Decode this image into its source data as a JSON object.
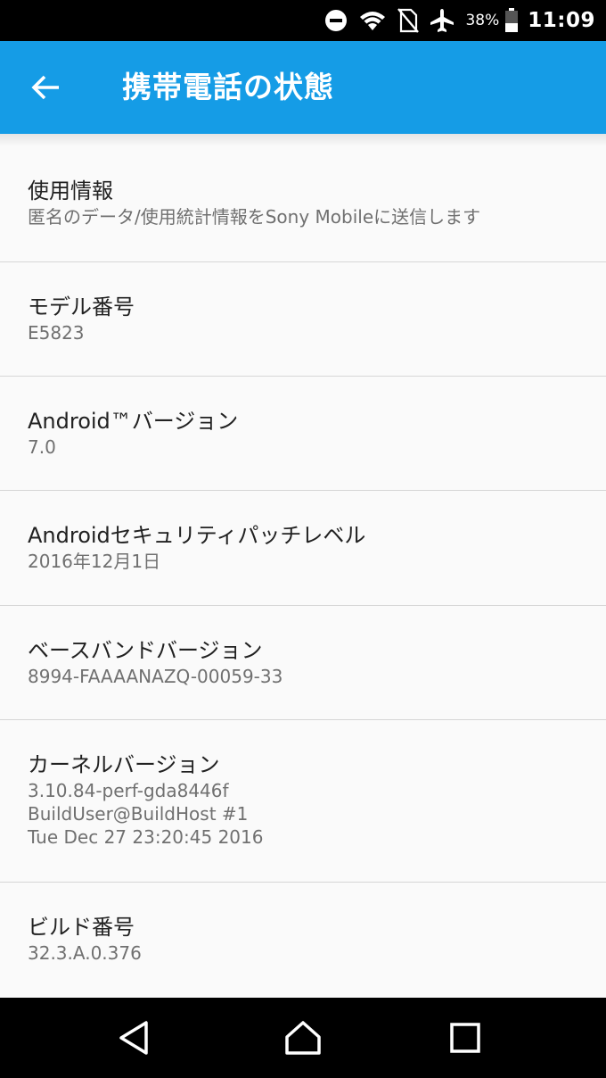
{
  "status_bar": {
    "battery_percent": "38%",
    "time": "11:09",
    "icons": [
      "do-not-disturb-icon",
      "wifi-icon",
      "no-sim-icon",
      "airplane-mode-icon",
      "battery-icon"
    ]
  },
  "app_bar": {
    "title": "携帯電話の状態",
    "back_icon": "arrow-back-icon"
  },
  "items": [
    {
      "title": "使用情報",
      "lines": [
        "匿名のデータ/使用統計情報をSony Mobileに送信します"
      ]
    },
    {
      "title": "モデル番号",
      "lines": [
        "E5823"
      ]
    },
    {
      "title": "Android™バージョン",
      "lines": [
        "7.0"
      ]
    },
    {
      "title": "Androidセキュリティパッチレベル",
      "lines": [
        "2016年12月1日"
      ]
    },
    {
      "title": "ベースバンドバージョン",
      "lines": [
        "8994-FAAAANAZQ-00059-33"
      ]
    },
    {
      "title": "カーネルバージョン",
      "lines": [
        "3.10.84-perf-gda8446f",
        "BuildUser@BuildHost #1",
        "Tue Dec 27 23:20:45 2016"
      ]
    },
    {
      "title": "ビルド番号",
      "lines": [
        "32.3.A.0.376"
      ]
    }
  ],
  "nav_bar": {
    "icons": [
      "nav-back-icon",
      "nav-home-icon",
      "nav-recents-icon"
    ]
  },
  "colors": {
    "app_bar": "#159ce6",
    "status_bar": "#000000",
    "background": "#fafafa"
  }
}
